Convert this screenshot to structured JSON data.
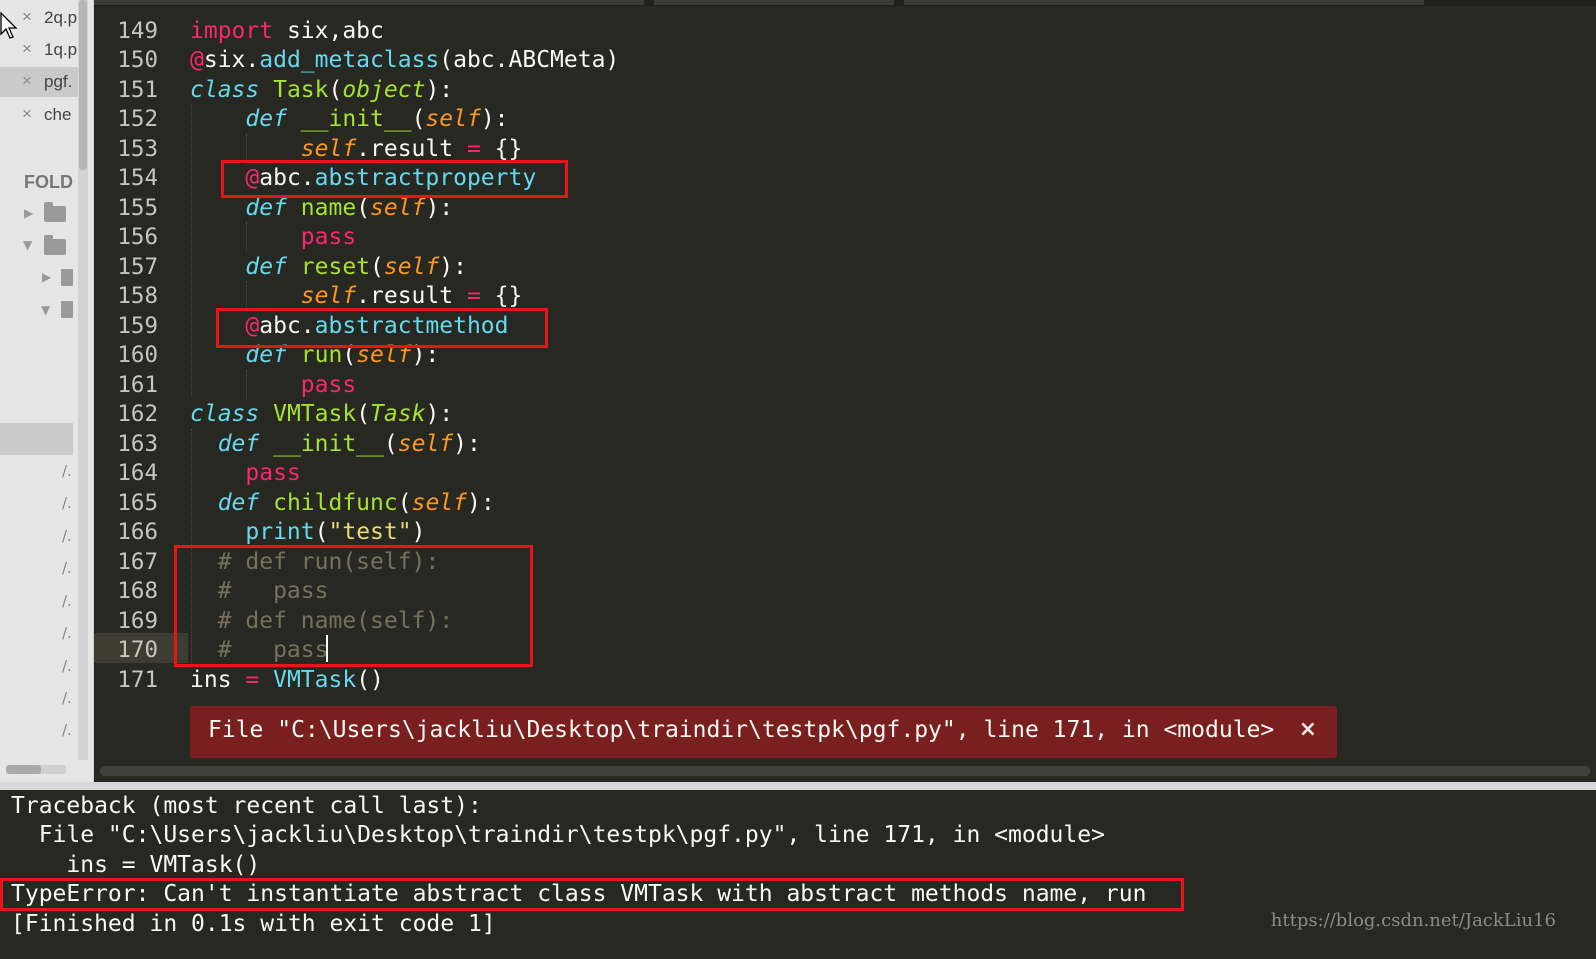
{
  "sidebar": {
    "open_files": [
      {
        "name": "2q.p",
        "active": false
      },
      {
        "name": "1q.p",
        "active": false
      },
      {
        "name": "pgf.",
        "active": true
      },
      {
        "name": "che",
        "active": false
      }
    ],
    "close_glyph": "×",
    "folders_header": "FOLD",
    "tree_slash": "/."
  },
  "editor": {
    "lines": [
      {
        "n": "149"
      },
      {
        "n": "150"
      },
      {
        "n": "151"
      },
      {
        "n": "152"
      },
      {
        "n": "153"
      },
      {
        "n": "154"
      },
      {
        "n": "155"
      },
      {
        "n": "156"
      },
      {
        "n": "157"
      },
      {
        "n": "158"
      },
      {
        "n": "159"
      },
      {
        "n": "160"
      },
      {
        "n": "161"
      },
      {
        "n": "162"
      },
      {
        "n": "163"
      },
      {
        "n": "164"
      },
      {
        "n": "165"
      },
      {
        "n": "166"
      },
      {
        "n": "167"
      },
      {
        "n": "168"
      },
      {
        "n": "169"
      },
      {
        "n": "170"
      },
      {
        "n": "171"
      }
    ],
    "current_line": "170",
    "error_phantom": {
      "text": "File \"C:\\Users\\jackliu\\Desktop\\traindir\\testpk\\pgf.py\", line 171, in <module>",
      "close": "×"
    }
  },
  "output": {
    "lines": [
      "Traceback (most recent call last):",
      "  File \"C:\\Users\\jackliu\\Desktop\\traindir\\testpk\\pgf.py\", line 171, in <module>",
      "    ins = VMTask()",
      "TypeError: Can't instantiate abstract class VMTask with abstract methods name, run",
      "[Finished in 0.1s with exit code 1]"
    ],
    "watermark": "https://blog.csdn.net/JackLiu16"
  },
  "colors": {
    "editor_bg": "#272822",
    "keyword": "#f92672",
    "function": "#a6e22e",
    "builtin": "#66d9ef",
    "self_param": "#fd971f",
    "string": "#e6db74",
    "comment": "#75715e",
    "highlight_box": "#e8141c",
    "error_phantom_bg": "#7a1f1f"
  }
}
